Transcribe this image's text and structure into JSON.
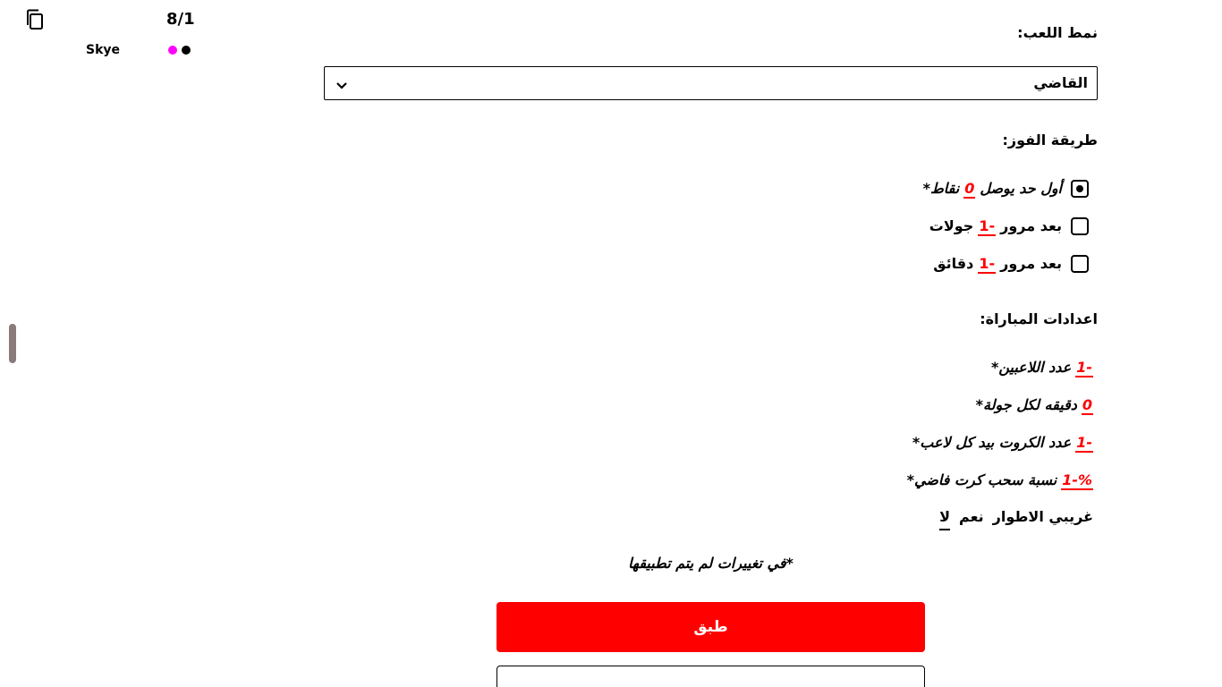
{
  "header": {
    "copy_icon": "copy-icon",
    "count": "8/1",
    "player_name": "Skye",
    "player_colors": [
      "#ff00ff",
      "#000000"
    ]
  },
  "form": {
    "game_mode_label": "نمط اللعب:",
    "game_mode_value": "القاضي",
    "win_method_label": "طريقة الفوز:",
    "win_options": [
      {
        "prefix": "أول حد يوصل",
        "value": "0",
        "suffix": "نقاط*",
        "checked": true
      },
      {
        "prefix": "بعد مرور",
        "value": "-1",
        "suffix": "جولات",
        "checked": false
      },
      {
        "prefix": "بعد مرور",
        "value": "-1",
        "suffix": "دقائق",
        "checked": false
      }
    ],
    "match_settings_label": "اعدادات المباراة:",
    "settings": [
      {
        "value": "-1",
        "label": "عدد اللاعبين*"
      },
      {
        "value": "0",
        "label": "دقيقه لكل جولة*"
      },
      {
        "value": "-1",
        "label": "عدد الكروت بيد كل لاعب*"
      },
      {
        "value": "%-1",
        "label": "نسبة سحب كرت فاضي*"
      }
    ],
    "strangers": {
      "label": "غريبي الاطوار",
      "yes": "نعم",
      "no": "لا",
      "selected": "no"
    },
    "unapplied_note": "*في تغييرات لم يتم تطبيقها",
    "apply_label": "طبق",
    "second_button_label": ""
  },
  "colors": {
    "accent": "#ff0000",
    "scroll_handle": "#8a7a7a"
  }
}
